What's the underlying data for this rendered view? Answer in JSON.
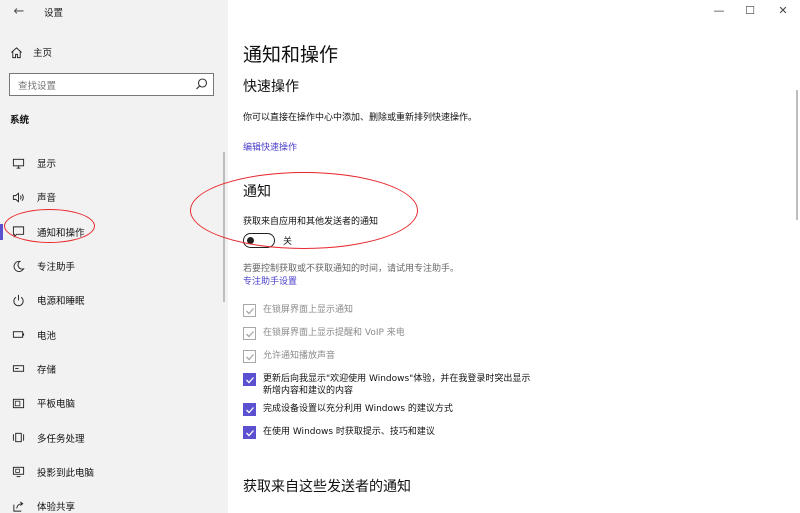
{
  "window": {
    "title": "设置",
    "minimize_glyph": "—",
    "maximize_glyph": "☐",
    "close_glyph": "✕"
  },
  "sidebar": {
    "home_label": "主页",
    "search_placeholder": "查找设置",
    "section_label": "系统",
    "items": [
      {
        "label": "显示",
        "icon": "display-icon"
      },
      {
        "label": "声音",
        "icon": "sound-icon"
      },
      {
        "label": "通知和操作",
        "icon": "notification-icon",
        "active": true
      },
      {
        "label": "专注助手",
        "icon": "moon-icon"
      },
      {
        "label": "电源和睡眠",
        "icon": "power-icon"
      },
      {
        "label": "电池",
        "icon": "battery-icon"
      },
      {
        "label": "存储",
        "icon": "storage-icon"
      },
      {
        "label": "平板电脑",
        "icon": "tablet-icon"
      },
      {
        "label": "多任务处理",
        "icon": "multitask-icon"
      },
      {
        "label": "投影到此电脑",
        "icon": "project-icon"
      },
      {
        "label": "体验共享",
        "icon": "share-icon"
      }
    ]
  },
  "main": {
    "title": "通知和操作",
    "quick_actions": {
      "heading": "快速操作",
      "description": "你可以直接在操作中心中添加、删除或重新排列快速操作。",
      "edit_link": "编辑快速操作"
    },
    "notifications": {
      "heading": "通知",
      "toggle_label": "获取来自应用和其他发送者的通知",
      "toggle_state": "关",
      "toggle_on": false,
      "focus_hint": "若要控制获取或不获取通知的时间，请试用专注助手。",
      "focus_link": "专注助手设置",
      "checkboxes": [
        {
          "label": "在锁屏界面上显示通知",
          "checked": true,
          "enabled": false
        },
        {
          "label": "在锁屏界面上显示提醒和 VoIP 来电",
          "checked": true,
          "enabled": false
        },
        {
          "label": "允许通知播放声音",
          "checked": true,
          "enabled": false
        },
        {
          "label": "更新后向我显示\"欢迎使用 Windows\"体验，并在我登录时突出显示",
          "label2": "新增内容和建议的内容",
          "checked": true,
          "enabled": true
        },
        {
          "label": "完成设备设置以充分利用 Windows 的建议方式",
          "checked": true,
          "enabled": true
        },
        {
          "label": "在使用 Windows 时获取提示、技巧和建议",
          "checked": true,
          "enabled": true
        }
      ]
    },
    "senders_heading": "获取来自这些发送者的通知"
  },
  "colors": {
    "accent": "#5a50d0",
    "link": "#4a3fc9",
    "annotation": "#e8272a",
    "sidebar_bg": "#f2f2f2"
  }
}
